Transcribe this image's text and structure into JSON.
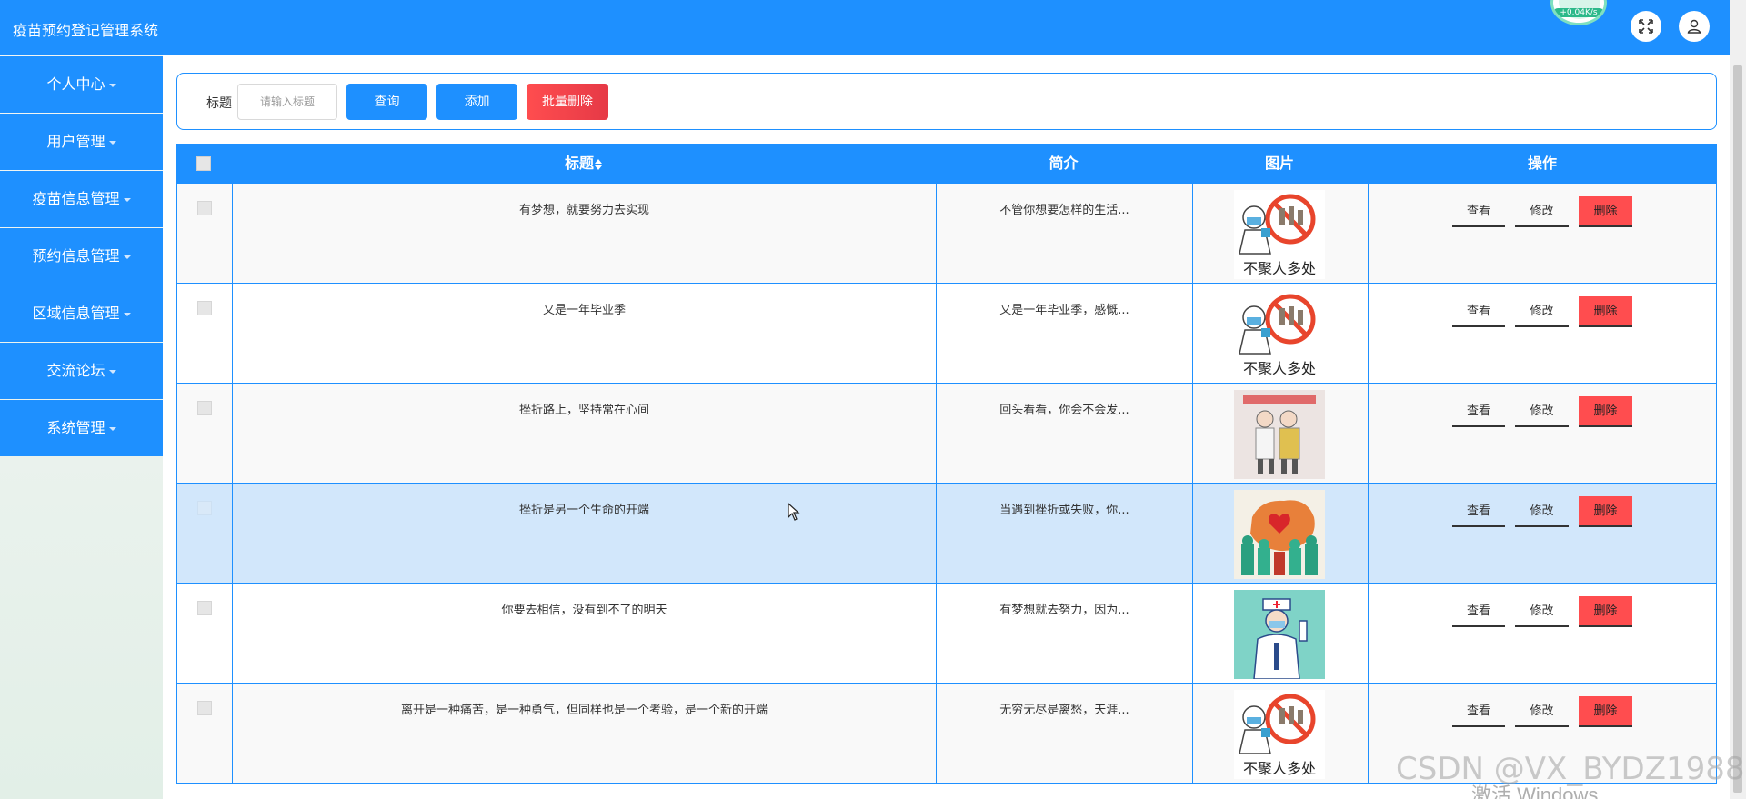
{
  "header": {
    "title": "疫苗预约登记管理系统",
    "net_speed": "+0.04K/s"
  },
  "sidebar": {
    "items": [
      {
        "label": "个人中心"
      },
      {
        "label": "用户管理"
      },
      {
        "label": "疫苗信息管理"
      },
      {
        "label": "预约信息管理"
      },
      {
        "label": "区域信息管理"
      },
      {
        "label": "交流论坛"
      },
      {
        "label": "系统管理"
      }
    ]
  },
  "toolbar": {
    "title_label": "标题",
    "title_placeholder": "请输入标题",
    "search_label": "查询",
    "add_label": "添加",
    "batch_delete_label": "批量删除"
  },
  "table": {
    "columns": {
      "title": "标题",
      "intro": "简介",
      "image": "图片",
      "actions": "操作"
    },
    "action_labels": {
      "view": "查看",
      "edit": "修改",
      "delete": "删除"
    },
    "rows": [
      {
        "title": "有梦想，就要努力去实现",
        "intro": "不管你想要怎样的生活...",
        "image": "no-gathering-poster"
      },
      {
        "title": "又是一年毕业季",
        "intro": "又是一年毕业季，感慨...",
        "image": "no-gathering-poster"
      },
      {
        "title": "挫折路上，坚持常在心间",
        "intro": "回头看看，你会不会发...",
        "image": "medical-workers-drawing"
      },
      {
        "title": "挫折是另一个生命的开端",
        "intro": "当遇到挫折或失败，你...",
        "image": "china-map-heart-poster"
      },
      {
        "title": "你要去相信，没有到不了的明天",
        "intro": "有梦想就去努力，因为...",
        "image": "nurse-illustration"
      },
      {
        "title": "离开是一种痛苦，是一种勇气，但同样也是一个考验，是一个新的开端",
        "intro": "无穷无尽是离愁，天涯...",
        "image": "no-gathering-poster"
      }
    ]
  },
  "overlay": {
    "watermark": "CSDN @VX_BYDZ1988",
    "windows_activate": "激活 Windows"
  },
  "colors": {
    "primary": "#1e90ff",
    "danger": "#ff4d4f"
  }
}
